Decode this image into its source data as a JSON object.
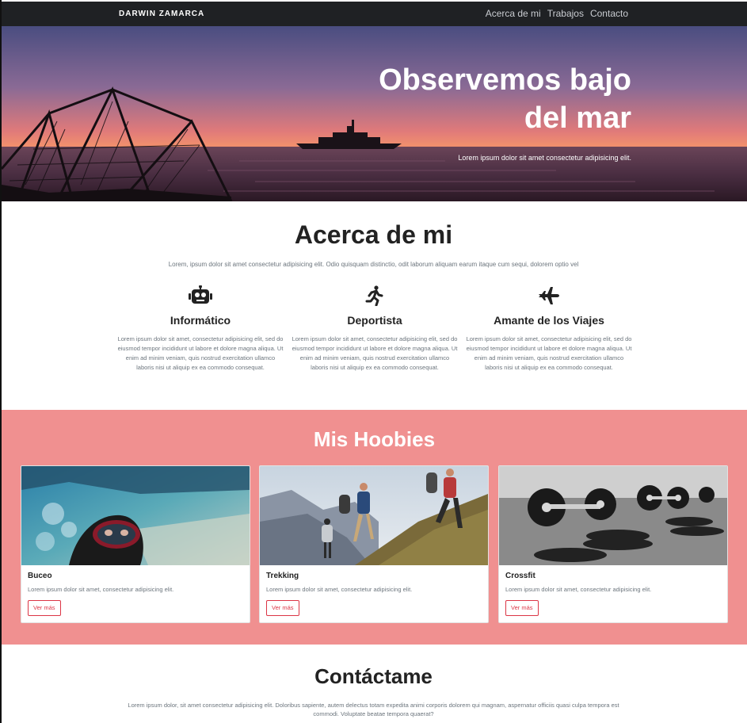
{
  "navbar": {
    "brand": "DARWIN ZAMARCA",
    "links": [
      "Acerca de mi",
      "Trabajos",
      "Contacto"
    ]
  },
  "hero": {
    "title": "Observemos bajo del mar",
    "subtitle": "Lorem ipsum dolor sit amet consectetur adipisicing elit."
  },
  "about": {
    "title": "Acerca de mi",
    "intro": "Lorem, ipsum dolor sit amet consectetur adipisicing elit. Odio quisquam distinctio, odit laborum aliquam earum itaque cum sequi, dolorem optio vel",
    "features": [
      {
        "icon": "robot-icon",
        "title": "Informático",
        "text": "Lorem ipsum dolor sit amet, consectetur adipisicing elit, sed do eiusmod tempor incididunt ut labore et dolore magna aliqua. Ut enim ad minim veniam, quis nostrud exercitation ullamco laboris nisi ut aliquip ex ea commodo consequat."
      },
      {
        "icon": "running-icon",
        "title": "Deportista",
        "text": "Lorem ipsum dolor sit amet, consectetur adipisicing elit, sed do eiusmod tempor incididunt ut labore et dolore magna aliqua. Ut enim ad minim veniam, quis nostrud exercitation ullamco laboris nisi ut aliquip ex ea commodo consequat."
      },
      {
        "icon": "plane-icon",
        "title": "Amante de los Viajes",
        "text": "Lorem ipsum dolor sit amet, consectetur adipisicing elit, sed do eiusmod tempor incididunt ut labore et dolore magna aliqua. Ut enim ad minim veniam, quis nostrud exercitation ullamco laboris nisi ut aliquip ex ea commodo consequat."
      }
    ]
  },
  "hobbies": {
    "title": "Mis Hoobies",
    "cards": [
      {
        "title": "Buceo",
        "text": "Lorem ipsum dolor sit amet, consectetur adipisicing elit.",
        "button": "Ver más"
      },
      {
        "title": "Trekking",
        "text": "Lorem ipsum dolor sit amet, consectetur adipisicing elit.",
        "button": "Ver más"
      },
      {
        "title": "Crossfit",
        "text": "Lorem ipsum dolor sit amet, consectetur adipisicing elit.",
        "button": "Ver más"
      }
    ]
  },
  "contact": {
    "title": "Contáctame",
    "text": "Lorem ipsum dolor, sit amet consectetur adipisicing elit. Doloribus sapiente, autem delectus totam expedita animi corporis dolorem qui magnam, aspernatur officiis quasi culpa tempora est commodi. Voluptate beatae tempora quaerat?"
  },
  "colors": {
    "navbar": "#1f2124",
    "hobbies_bg": "#f09090",
    "button_accent": "#dc3545"
  }
}
